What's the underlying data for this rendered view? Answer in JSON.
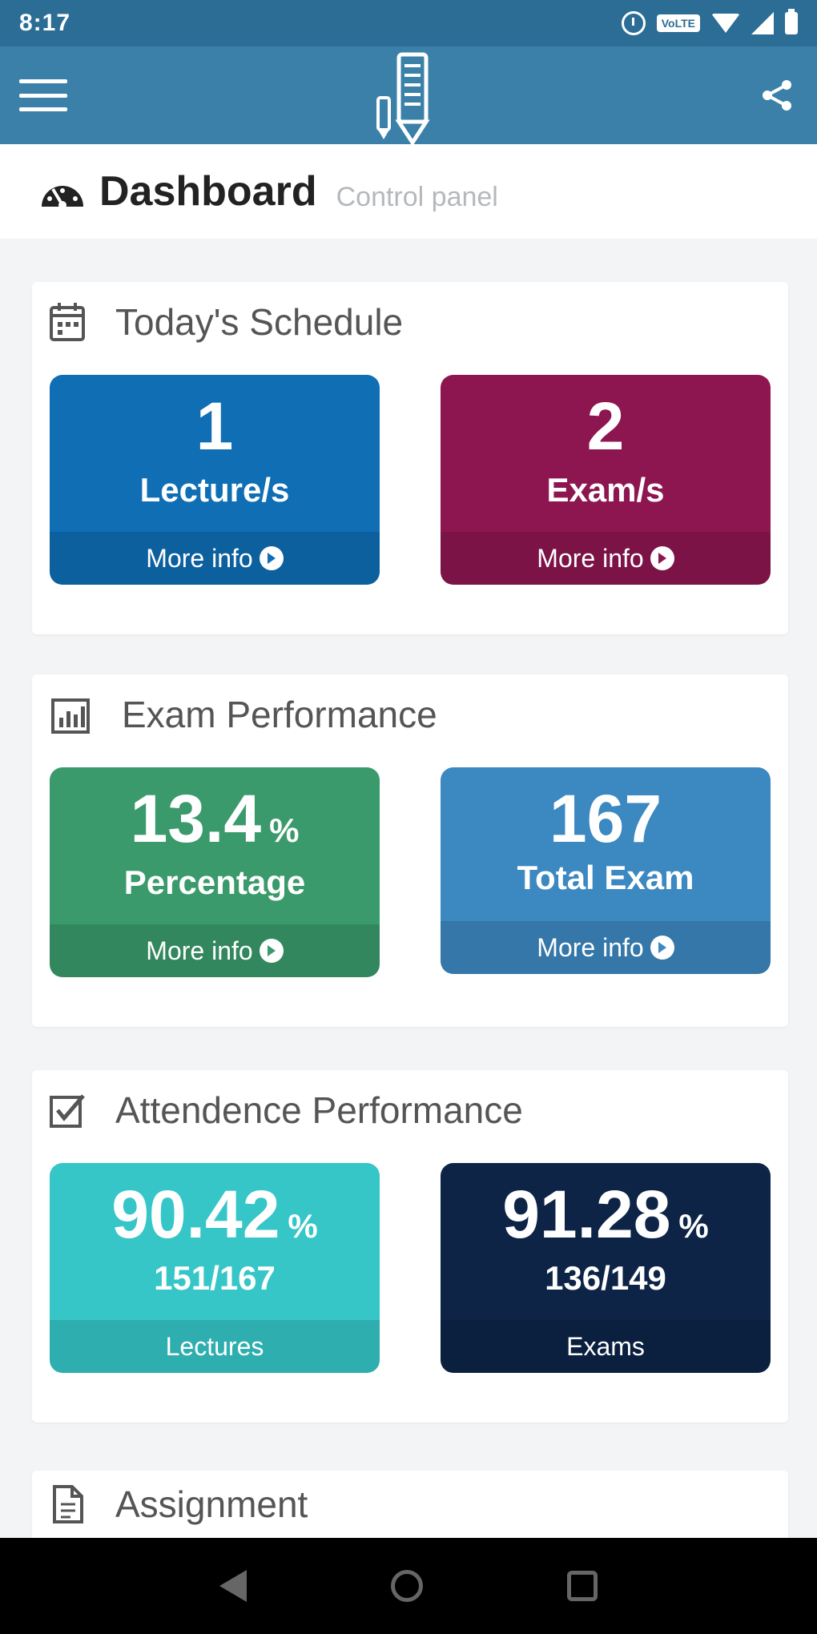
{
  "status_bar": {
    "time": "8:17",
    "volte": "VoLTE",
    "icons": [
      "alarm-icon",
      "volte-icon",
      "wifi-icon",
      "signal-icon",
      "battery-icon"
    ]
  },
  "app_bar": {
    "icons": [
      "menu-icon",
      "app-logo",
      "share-icon"
    ],
    "color": "#3a80a9"
  },
  "page_header": {
    "title": "Dashboard",
    "subtitle": "Control panel"
  },
  "sections": {
    "schedule": {
      "title": "Today's Schedule",
      "icon": "calendar-icon",
      "tiles": [
        {
          "value": "1",
          "label": "Lecture/s",
          "footer": "More info",
          "color": "#0f6eb4"
        },
        {
          "value": "2",
          "label": "Exam/s",
          "footer": "More info",
          "color": "#8e1650"
        }
      ]
    },
    "exam_performance": {
      "title": "Exam Performance",
      "icon": "chart-icon",
      "tiles": [
        {
          "value": "13.4",
          "unit": "%",
          "label": "Percentage",
          "footer": "More info",
          "color": "#3b9a6c"
        },
        {
          "value": "167",
          "label": "Total Exam",
          "footer": "More info",
          "color": "#3c88c0"
        }
      ]
    },
    "attendance": {
      "title": "Attendence Performance",
      "icon": "checkbox-icon",
      "tiles": [
        {
          "value": "90.42",
          "unit": "%",
          "label": "151/167",
          "footer": "Lectures",
          "color": "#36c6c8"
        },
        {
          "value": "91.28",
          "unit": "%",
          "label": "136/149",
          "footer": "Exams",
          "color": "#0d2447"
        }
      ]
    },
    "assignment": {
      "title": "Assignment",
      "icon": "document-icon"
    }
  },
  "nav_bar": {
    "icons": [
      "back-icon",
      "home-icon",
      "recent-apps-icon"
    ]
  }
}
